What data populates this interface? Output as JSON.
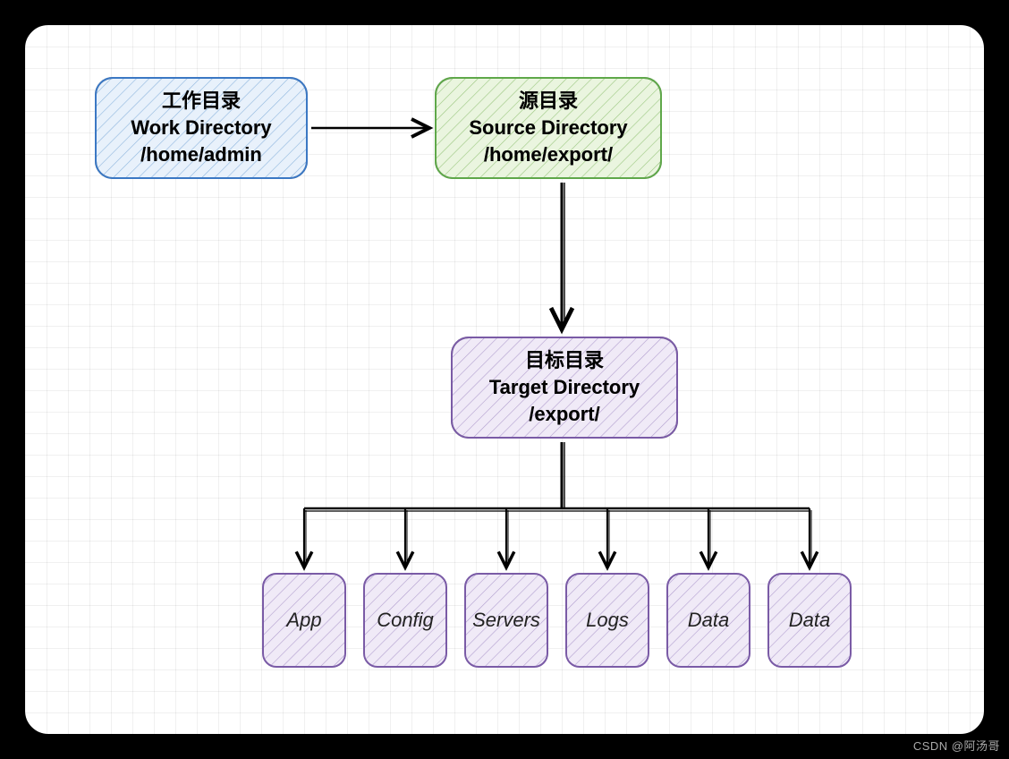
{
  "nodes": {
    "work": {
      "line1": "工作目录",
      "line2": "Work Directory",
      "line3": "/home/admin"
    },
    "source": {
      "line1": "源目录",
      "line2": "Source Directory",
      "line3": "/home/export/"
    },
    "target": {
      "line1": "目标目录",
      "line2": "Target Directory",
      "line3": "/export/"
    }
  },
  "children": {
    "c1": "App",
    "c2": "Config",
    "c3": "Servers",
    "c4": "Logs",
    "c5": "Data",
    "c6": "Data"
  },
  "colors": {
    "workStroke": "#3b78c4",
    "workFill": "#e8f1fb",
    "sourceStroke": "#5fa84a",
    "sourceFill": "#eaf5df",
    "targetStroke": "#7a5ba6",
    "targetFill": "#f0eaf7",
    "childStroke": "#7a5ba6",
    "childFill": "#f0eaf7"
  },
  "watermark": "",
  "credit": "CSDN @阿汤哥"
}
